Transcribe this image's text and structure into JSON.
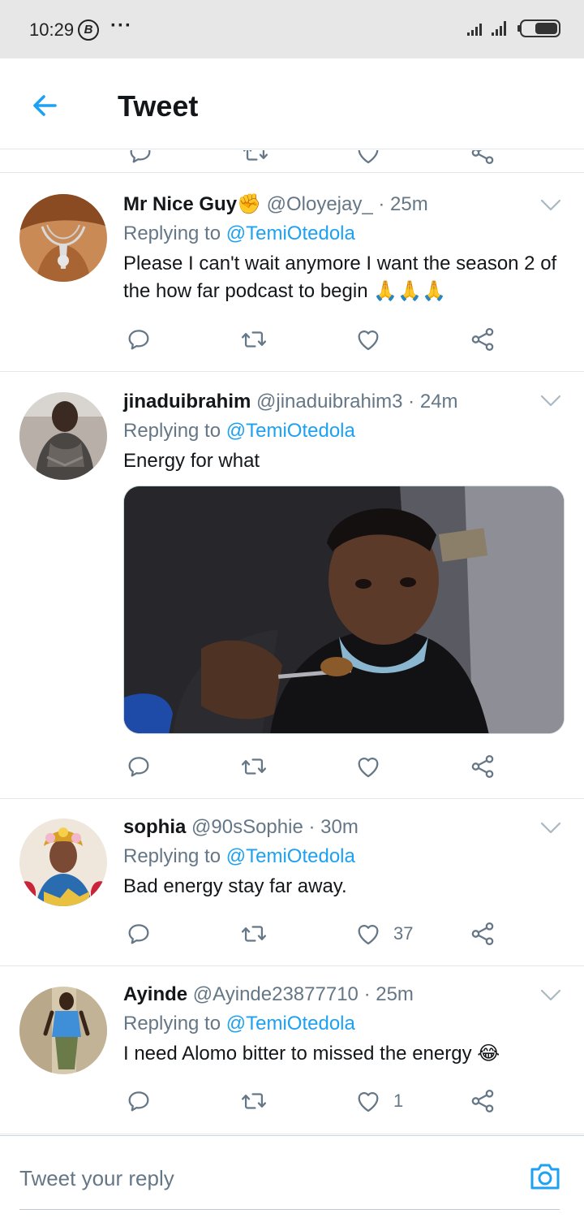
{
  "status_bar": {
    "time": "10:29",
    "b_badge": "B",
    "more": "···"
  },
  "app_bar": {
    "title": "Tweet"
  },
  "tweets": [
    {
      "name": "Mr Nice Guy",
      "emoji": "✊",
      "handle": "@Oloyejay_",
      "separator": "·",
      "time": "25m",
      "replying_prefix": "Replying to ",
      "replying_to": "@TemiOtedola",
      "text": "Please I can't wait anymore I want the season 2 of the how far podcast to begin 🙏🙏🙏",
      "likes": ""
    },
    {
      "name": "jinaduibrahim",
      "emoji": "",
      "handle": "@jinaduibrahim3",
      "separator": "·",
      "time": "24m",
      "replying_prefix": "Replying to ",
      "replying_to": "@TemiOtedola",
      "text": "Energy for what",
      "likes": ""
    },
    {
      "name": "sophia",
      "emoji": "",
      "handle": "@90sSophie",
      "separator": "·",
      "time": "30m",
      "replying_prefix": "Replying to ",
      "replying_to": "@TemiOtedola",
      "text": "Bad energy stay far away.",
      "likes": "37"
    },
    {
      "name": "Ayinde",
      "emoji": "",
      "handle": "@Ayinde23877710",
      "separator": "·",
      "time": "25m",
      "replying_prefix": "Replying to ",
      "replying_to": "@TemiOtedola",
      "text": "I need Alomo bitter to missed the energy 😂",
      "likes": "1"
    }
  ],
  "reply_bar": {
    "placeholder": "Tweet your reply"
  },
  "icons": {
    "back": "arrow-left-icon",
    "reply": "comment-icon",
    "retweet": "retweet-icon",
    "like": "heart-icon",
    "share": "share-icon",
    "more": "chevron-down-icon",
    "camera": "camera-icon"
  },
  "colors": {
    "accent": "#1da1f2",
    "text": "#14171a",
    "secondary": "#657786",
    "divider": "#e1e8ed",
    "status_bar": "#e7e7e7"
  }
}
